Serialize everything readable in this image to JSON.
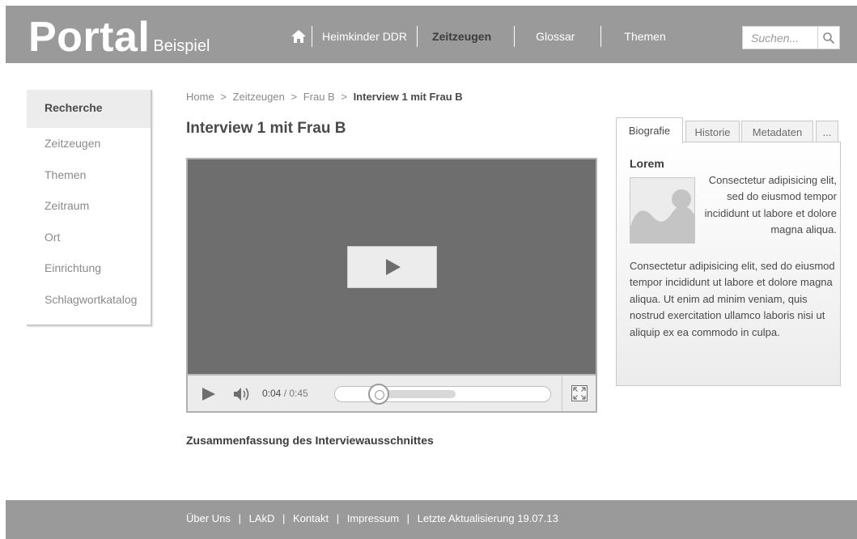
{
  "header": {
    "logo_main": "Portal",
    "logo_sub": "Beispiel",
    "nav": [
      "Heimkinder DDR",
      "Zeitzeugen",
      "Glossar",
      "Themen"
    ],
    "active_nav": "Zeitzeugen",
    "search_placeholder": "Suchen...",
    "icons": {
      "home": "home-icon",
      "search": "search-icon"
    }
  },
  "sidebar": {
    "items": [
      "Recherche",
      "Zeitzeugen",
      "Themen",
      "Zeitraum",
      "Ort",
      "Einrichtung",
      "Schlagwortkatalog"
    ],
    "active": "Recherche"
  },
  "breadcrumb": {
    "items": [
      "Home",
      "Zeitzeugen",
      "Frau B"
    ],
    "separator": ">",
    "current": "Interview 1 mit Frau B"
  },
  "page_title": "Interview 1 mit Frau B",
  "player": {
    "current_time": "0:04",
    "separator": " / ",
    "total_time": "0:45",
    "progress_fraction": 0.09,
    "buffered_fraction": 0.53
  },
  "summary_heading": "Zusammenfassung des Interviewausschnittes",
  "tabs": {
    "items": [
      "Biografie",
      "Historie",
      "Metadaten",
      "..."
    ],
    "active": "Biografie"
  },
  "panel": {
    "title": "Lorem",
    "text_beside_image": "Consectetur adipisicing elit, sed do eiusmod tempor incididunt ut labore et dolore magna aliqua.",
    "text_below": "Consectetur adipisicing elit, sed do eiusmod tempor incididunt ut labore et dolore magna aliqua. Ut enim ad minim veniam, quis nostrud exercitation ullamco laboris nisi ut aliquip ex ea commodo in culpa."
  },
  "footer": {
    "links": [
      "Über Uns",
      "LAkD",
      "Kontakt",
      "Impressum"
    ],
    "separator": "|",
    "last_update": "Letzte Aktualisierung 19.07.13"
  },
  "colors": {
    "header_bg": "#9a9a9a",
    "video_bg": "#6e6e6e",
    "text": "#4a4a4a",
    "muted": "#8a8a8a"
  }
}
